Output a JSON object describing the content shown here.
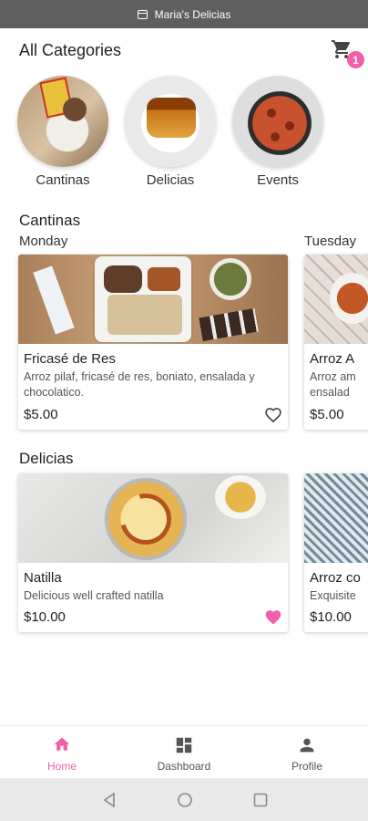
{
  "app": {
    "title": "Maria's Delicias"
  },
  "header": {
    "title": "All Categories",
    "cart_count": "1"
  },
  "categories": [
    {
      "label": "Cantinas"
    },
    {
      "label": "Delicias"
    },
    {
      "label": "Events"
    }
  ],
  "cantinas": {
    "title": "Cantinas",
    "days": [
      "Monday",
      "Tuesday"
    ],
    "cards": [
      {
        "name": "Fricasé de Res",
        "description": "Arroz pilaf, fricasé de res, boniato, ensalada y chocolatico.",
        "price": "$5.00",
        "favorite": false
      },
      {
        "name": "Arroz A",
        "description": "Arroz am ensalad",
        "price": "$5.00",
        "favorite": false
      }
    ]
  },
  "delicias": {
    "title": "Delicias",
    "cards": [
      {
        "name": "Natilla",
        "description": "Delicious well crafted natilla",
        "price": "$10.00",
        "favorite": true
      },
      {
        "name": "Arroz co",
        "description": "Exquisite",
        "price": "$10.00",
        "favorite": false
      }
    ]
  },
  "bottom_nav": [
    {
      "label": "Home",
      "active": true
    },
    {
      "label": "Dashboard",
      "active": false
    },
    {
      "label": "Profile",
      "active": false
    }
  ],
  "colors": {
    "accent": "#f25fa8",
    "topbar": "#5f5f5f",
    "inactive": "#555555"
  },
  "icons": {
    "cart": "shopping-cart-icon",
    "heart": "heart-icon",
    "home": "home-icon",
    "dashboard": "dashboard-icon",
    "profile": "person-icon"
  }
}
